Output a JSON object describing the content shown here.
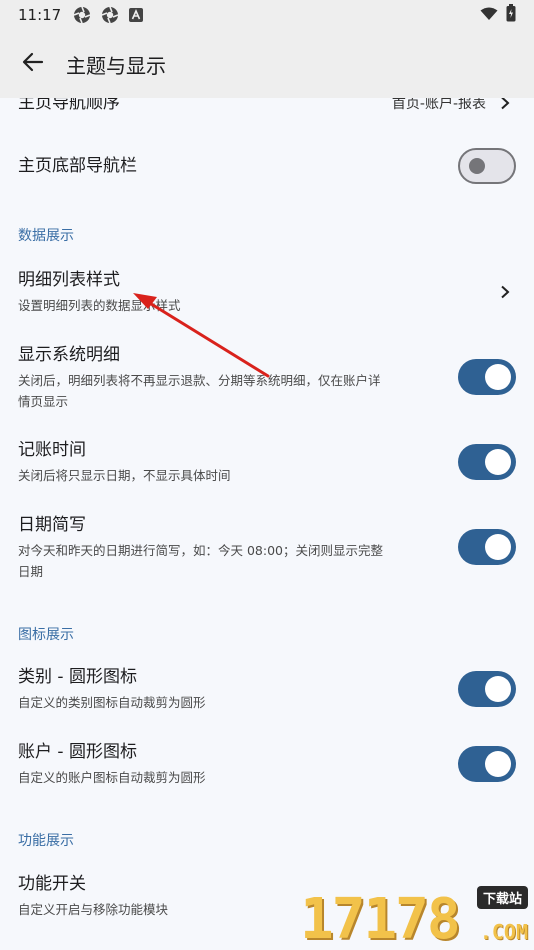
{
  "status_bar": {
    "time": "11:17",
    "icons": [
      "aperture-icon",
      "aperture-icon",
      "a-badge-icon"
    ],
    "right_icons": [
      "wifi-icon",
      "battery-icon"
    ]
  },
  "app_bar": {
    "title": "主题与显示",
    "back_icon": "arrow-left-icon"
  },
  "rows": {
    "home_nav_order": {
      "title": "主页导航顺序",
      "value": "首页-账户-报表"
    },
    "bottom_nav": {
      "title": "主页底部导航栏",
      "enabled": false
    },
    "section_data": "数据展示",
    "detail_list_style": {
      "title": "明细列表样式",
      "subtitle": "设置明细列表的数据显示样式"
    },
    "show_system_detail": {
      "title": "显示系统明细",
      "subtitle_line1": "关闭后，明细列表将不再显示退款、分期等系统明细，仅在账户详",
      "subtitle_line2": "情页显示",
      "enabled": true
    },
    "record_time": {
      "title": "记账时间",
      "subtitle": "关闭后将只显示日期，不显示具体时间",
      "enabled": true
    },
    "date_short": {
      "title": "日期简写",
      "subtitle_line1": "对今天和昨天的日期进行简写，如：今天 08:00；关闭则显示完整",
      "subtitle_line2": "日期",
      "enabled": true
    },
    "section_icon": "图标展示",
    "category_round": {
      "title": "类别 - 圆形图标",
      "subtitle": "自定义的类别图标自动裁剪为圆形",
      "enabled": true
    },
    "account_round": {
      "title": "账户 - 圆形图标",
      "subtitle": "自定义的账户图标自动裁剪为圆形",
      "enabled": true
    },
    "section_feature": "功能展示",
    "feature_switch": {
      "title": "功能开关",
      "subtitle": "自定义开启与移除功能模块"
    }
  },
  "watermark": {
    "digits": "17178",
    "badge": "下载站",
    "domain": ".COM"
  },
  "colors": {
    "accent": "#2f6193",
    "section_header": "#3a6ea5",
    "annotation_arrow": "#d9221c"
  }
}
